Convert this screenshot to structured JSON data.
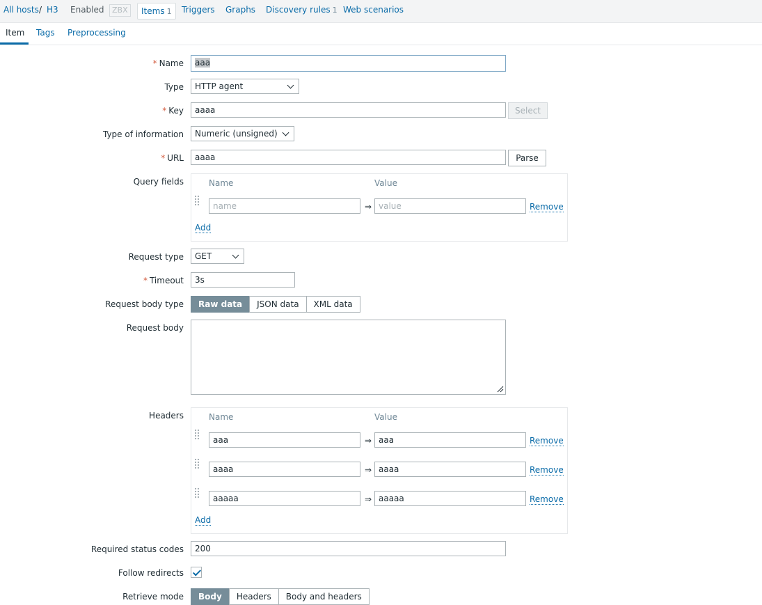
{
  "nav": {
    "all_hosts": "All hosts",
    "separator": "/",
    "host": "H3",
    "status": "Enabled",
    "zbx": "ZBX",
    "items": "Items",
    "items_count": "1",
    "triggers": "Triggers",
    "graphs": "Graphs",
    "discovery": "Discovery rules",
    "discovery_count": "1",
    "web": "Web scenarios"
  },
  "tabs": {
    "item": "Item",
    "tags": "Tags",
    "preprocessing": "Preprocessing"
  },
  "form": {
    "name": {
      "label": "Name",
      "value": "aaa"
    },
    "type": {
      "label": "Type",
      "value": "HTTP agent"
    },
    "key": {
      "label": "Key",
      "value": "aaaa",
      "select_button": "Select"
    },
    "type_info": {
      "label": "Type of information",
      "value": "Numeric (unsigned)"
    },
    "url": {
      "label": "URL",
      "value": "aaaa",
      "parse_button": "Parse"
    },
    "query_fields": {
      "label": "Query fields",
      "col_name": "Name",
      "col_value": "Value",
      "name_placeholder": "name",
      "value_placeholder": "value",
      "arrow": "⇒",
      "remove": "Remove",
      "add": "Add"
    },
    "request_type": {
      "label": "Request type",
      "value": "GET"
    },
    "timeout": {
      "label": "Timeout",
      "value": "3s"
    },
    "body_type": {
      "label": "Request body type",
      "options": [
        "Raw data",
        "JSON data",
        "XML data"
      ],
      "selected": "Raw data"
    },
    "request_body": {
      "label": "Request body",
      "value": ""
    },
    "headers": {
      "label": "Headers",
      "col_name": "Name",
      "col_value": "Value",
      "rows": [
        {
          "name": "aaa",
          "value": "aaa"
        },
        {
          "name": "aaaa",
          "value": "aaaa"
        },
        {
          "name": "aaaaa",
          "value": "aaaaa"
        }
      ],
      "arrow": "⇒",
      "remove": "Remove",
      "add": "Add"
    },
    "status_codes": {
      "label": "Required status codes",
      "value": "200"
    },
    "follow_redirects": {
      "label": "Follow redirects",
      "checked": true
    },
    "retrieve_mode": {
      "label": "Retrieve mode",
      "options": [
        "Body",
        "Headers",
        "Body and headers"
      ],
      "selected": "Body"
    }
  },
  "colors": {
    "accent": "#0a6ba8",
    "segment_on": "#768d99",
    "required": "#d35b3e"
  }
}
